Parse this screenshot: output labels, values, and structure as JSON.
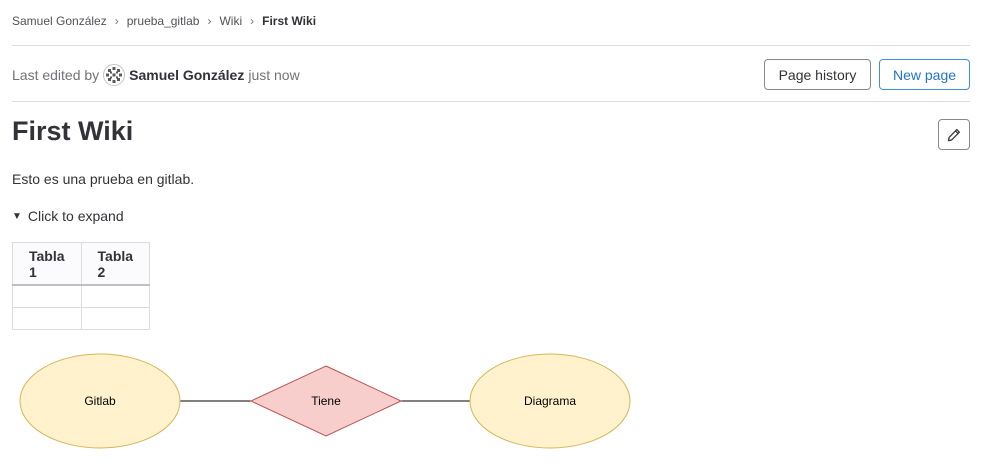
{
  "breadcrumb": {
    "items": [
      "Samuel González",
      "prueba_gitlab",
      "Wiki"
    ],
    "current": "First Wiki"
  },
  "edited": {
    "prefix": "Last edited by",
    "author": "Samuel González",
    "time": "just now"
  },
  "buttons": {
    "page_history": "Page history",
    "new_page": "New page"
  },
  "page": {
    "title": "First Wiki",
    "paragraph": "Esto es una prueba en gitlab.",
    "details_summary": "Click to expand"
  },
  "table": {
    "headers": [
      "Tabla 1",
      "Tabla 2"
    ],
    "rows": [
      [
        "",
        ""
      ],
      [
        "",
        ""
      ]
    ]
  },
  "diagram": {
    "left_entity": "Gitlab",
    "relationship": "Tiene",
    "right_entity": "Diagrama",
    "entity_fill": "#fff2cc",
    "entity_stroke": "#d6b656",
    "relation_fill": "#f8cecc",
    "relation_stroke": "#b85450"
  },
  "icons": {
    "edit": "pencil-icon",
    "avatar": "identicon-avatar",
    "expand": "triangle-down-icon"
  },
  "colors": {
    "primary_blue": "#1f75cb",
    "text": "#333238",
    "muted": "#737278"
  }
}
